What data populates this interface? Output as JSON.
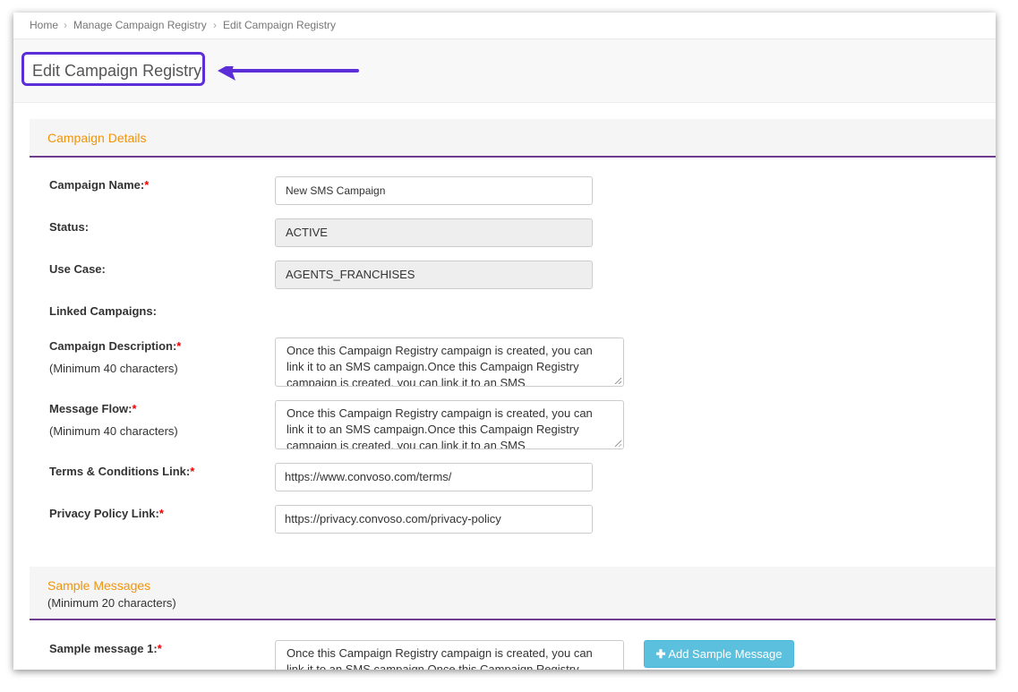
{
  "breadcrumb": [
    "Home",
    "Manage Campaign Registry",
    "Edit Campaign Registry"
  ],
  "page_title": "Edit Campaign Registry",
  "colors": {
    "highlight": "#5b2ed8",
    "section_title": "#f0940a",
    "section_rule": "#6e3d8e",
    "button": "#5bc0de",
    "required": "#e00"
  },
  "campaign_details": {
    "title": "Campaign Details",
    "fields": {
      "campaign_name": {
        "label": "Campaign Name:",
        "value": "New SMS Campaign"
      },
      "status": {
        "label": "Status:",
        "value": "ACTIVE"
      },
      "use_case": {
        "label": "Use Case:",
        "value": "AGENTS_FRANCHISES"
      },
      "linked_campaigns": {
        "label": "Linked Campaigns:"
      },
      "campaign_description": {
        "label": "Campaign Description:",
        "hint": "(Minimum 40 characters)",
        "value": "Once this Campaign Registry campaign is created, you can link it to an SMS campaign.Once this Campaign Registry campaign is created, you can link it to an SMS"
      },
      "message_flow": {
        "label": "Message Flow:",
        "hint": "(Minimum 40 characters)",
        "value": "Once this Campaign Registry campaign is created, you can link it to an SMS campaign.Once this Campaign Registry campaign is created, you can link it to an SMS"
      },
      "terms_link": {
        "label": "Terms & Conditions Link:",
        "value": "https://www.convoso.com/terms/"
      },
      "privacy_link": {
        "label": "Privacy Policy Link:",
        "value": "https://privacy.convoso.com/privacy-policy"
      }
    }
  },
  "sample_messages": {
    "title": "Sample Messages",
    "subtitle": "(Minimum 20 characters)",
    "message_1": {
      "label": "Sample message 1:",
      "value": "Once this Campaign Registry campaign is created, you can link it to an SMS campaign.Once this Campaign Registry"
    },
    "add_button": "Add Sample Message"
  },
  "icons": {
    "arrow": "left-arrow-annotation",
    "add": "plus-icon",
    "separator": "chevron-right"
  }
}
